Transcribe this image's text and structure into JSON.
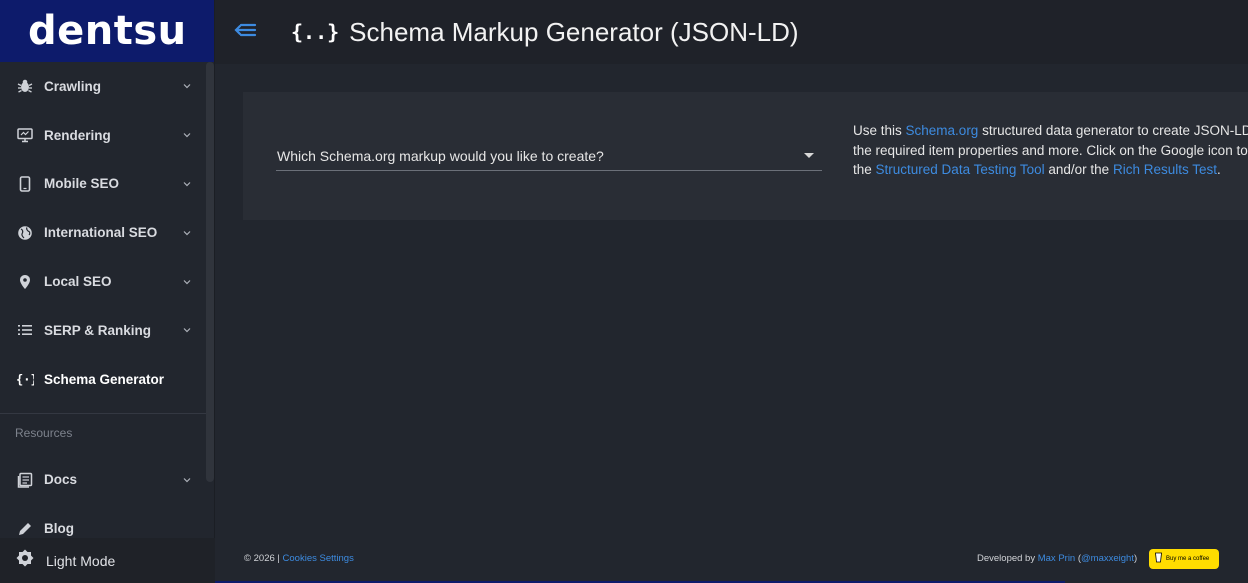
{
  "brand": {
    "logo_text": "dentsu",
    "color": "#0d1b6b"
  },
  "header": {
    "title": "Schema Markup Generator (JSON-LD)",
    "title_icon": "{..}"
  },
  "sidebar": {
    "items": [
      {
        "label": "Crawling",
        "icon": "bug-icon"
      },
      {
        "label": "Rendering",
        "icon": "monitor-icon"
      },
      {
        "label": "Mobile SEO",
        "icon": "phone-icon"
      },
      {
        "label": "International SEO",
        "icon": "globe-icon"
      },
      {
        "label": "Local SEO",
        "icon": "pin-icon"
      },
      {
        "label": "SERP & Ranking",
        "icon": "list-icon"
      },
      {
        "label": "Schema Generator",
        "icon": "braces-icon"
      }
    ],
    "resources_label": "Resources",
    "resources": [
      {
        "label": "Docs",
        "icon": "docs-icon"
      },
      {
        "label": "Blog",
        "icon": "pencil-icon"
      }
    ],
    "light_mode_label": "Light Mode"
  },
  "main": {
    "select_placeholder": "Which Schema.org markup would you like to create?",
    "desc": {
      "t1": "Use this ",
      "link1": "Schema.org",
      "t2": " structured data generator to create JSON-LD",
      "t3": "the required item properties and more. Click on the Google icon to",
      "t4": "the ",
      "link2": "Structured Data Testing Tool",
      "t5": " and/or the ",
      "link3": "Rich Results Test",
      "t6": "."
    }
  },
  "footer": {
    "copyright": "© 2026 | ",
    "cookies": "Cookies Settings",
    "developed_by": "Developed by ",
    "author": "Max Prin",
    "open_paren": " (",
    "handle": "@maxxeight",
    "close_paren": ")",
    "coffee": "Buy me a coffee"
  },
  "colors": {
    "accent": "#3d8be0",
    "coffee": "#ffdd00"
  }
}
